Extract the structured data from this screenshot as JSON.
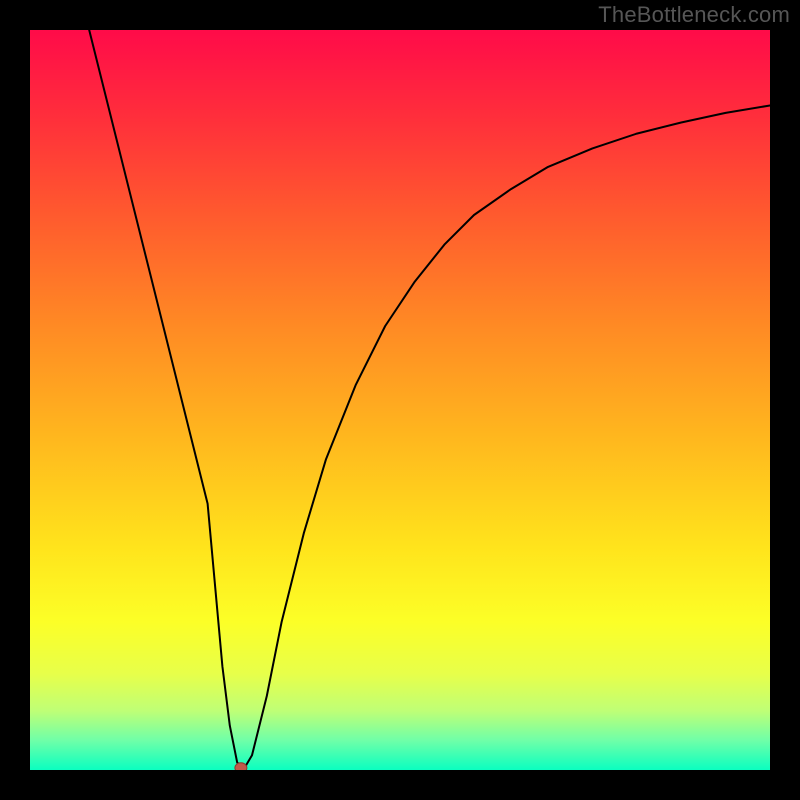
{
  "watermark": "TheBottleneck.com",
  "chart_data": {
    "type": "line",
    "title": "",
    "xlabel": "",
    "ylabel": "",
    "ylim": [
      0,
      100
    ],
    "xlim": [
      0,
      100
    ],
    "series": [
      {
        "name": "curve",
        "x": [
          8,
          12,
          16,
          20,
          24,
          26,
          27,
          28,
          29,
          30,
          32,
          34,
          37,
          40,
          44,
          48,
          52,
          56,
          60,
          65,
          70,
          76,
          82,
          88,
          94,
          100
        ],
        "values": [
          100,
          84,
          68,
          52,
          36,
          14,
          6,
          1,
          0.3,
          2,
          10,
          20,
          32,
          42,
          52,
          60,
          66,
          71,
          75,
          78.5,
          81.5,
          84,
          86,
          87.5,
          88.8,
          89.8
        ]
      }
    ],
    "marker": {
      "x": 28.5,
      "y": 0.3
    },
    "gradient_stops": [
      {
        "pos": 0,
        "color": "#ff0b49"
      },
      {
        "pos": 100,
        "color": "#0affc0"
      }
    ]
  }
}
